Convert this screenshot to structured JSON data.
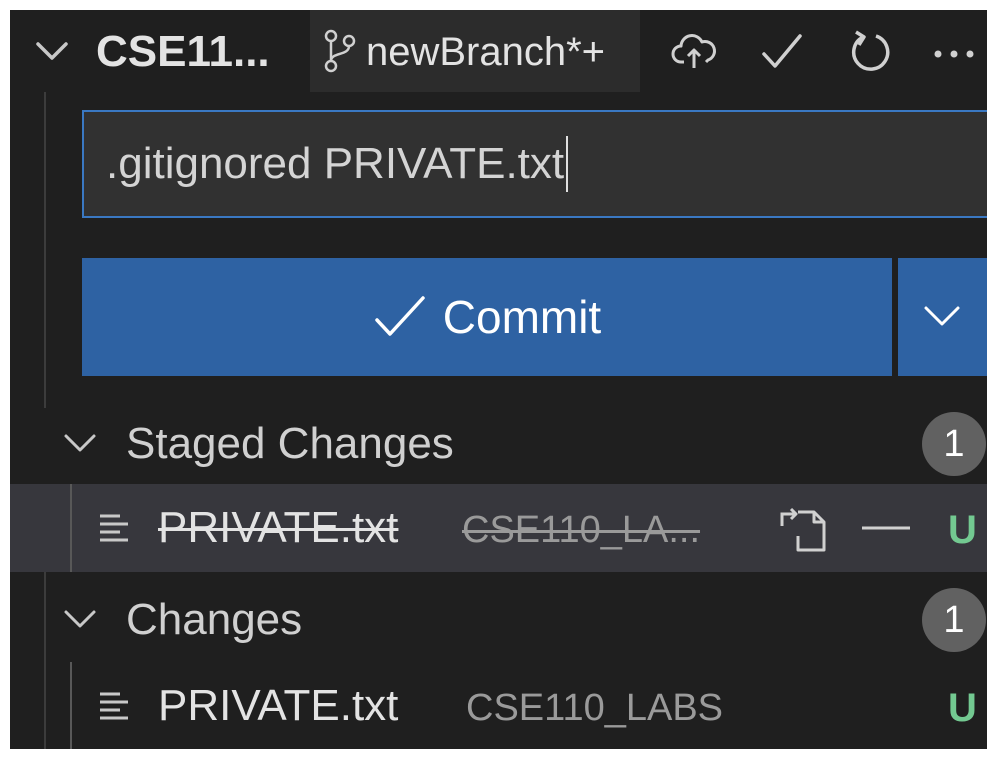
{
  "header": {
    "repo_title": "CSE11...",
    "branch": "newBranch*+",
    "actions": [
      {
        "name": "publish-branch",
        "icon": "cloud-upload-icon"
      },
      {
        "name": "commit",
        "icon": "check-icon"
      },
      {
        "name": "refresh",
        "icon": "refresh-icon"
      },
      {
        "name": "more",
        "icon": "ellipsis-icon"
      }
    ]
  },
  "commit": {
    "message": ".gitignored PRIVATE.txt",
    "button_label": "Commit"
  },
  "staged": {
    "title": "Staged Changes",
    "count": "1",
    "files": [
      {
        "name": "PRIVATE.txt",
        "dir": "CSE110_LA...",
        "status": "U",
        "deleted_style": true
      }
    ]
  },
  "changes": {
    "title": "Changes",
    "count": "1",
    "files": [
      {
        "name": "PRIVATE.txt",
        "dir": "CSE110_LABS",
        "status": "U",
        "deleted_style": false
      }
    ]
  },
  "colors": {
    "background": "#1f1f1f",
    "accent": "#2e62a3",
    "input_border": "#3a78c2",
    "untracked": "#73c991",
    "badge": "#616161"
  }
}
